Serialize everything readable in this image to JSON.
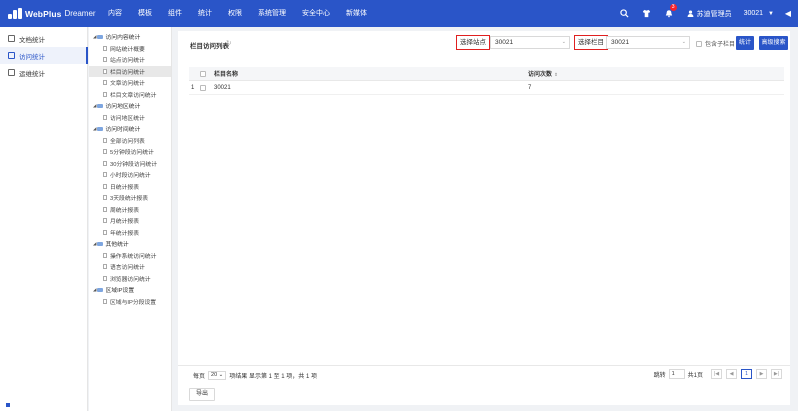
{
  "brand": {
    "name": "WebPlus",
    "sub": "Dreamer"
  },
  "nav": [
    "内容",
    "模板",
    "组件",
    "统计",
    "权限",
    "系统管理",
    "安全中心",
    "新媒体"
  ],
  "topbar": {
    "notification_count": "3",
    "user_name": "苏迪管理员",
    "site": "30021"
  },
  "sidebar": {
    "items": [
      {
        "label": "文档统计"
      },
      {
        "label": "访问统计"
      },
      {
        "label": "运维统计"
      }
    ]
  },
  "tree": {
    "nodes": [
      {
        "label": "访问内容统计",
        "type": "group"
      },
      {
        "label": "网站统计概要",
        "type": "leaf"
      },
      {
        "label": "站点访问统计",
        "type": "leaf"
      },
      {
        "label": "栏目访问统计",
        "type": "leaf"
      },
      {
        "label": "文章访问统计",
        "type": "leaf"
      },
      {
        "label": "栏目文章访问统计",
        "type": "leaf"
      },
      {
        "label": "访问地区统计",
        "type": "group"
      },
      {
        "label": "访问地区统计",
        "type": "leaf"
      },
      {
        "label": "访问时间统计",
        "type": "group"
      },
      {
        "label": "全部访问列表",
        "type": "leaf"
      },
      {
        "label": "5分钟段访问统计",
        "type": "leaf"
      },
      {
        "label": "30分钟段访问统计",
        "type": "leaf"
      },
      {
        "label": "小时段访问统计",
        "type": "leaf"
      },
      {
        "label": "日统计报表",
        "type": "leaf"
      },
      {
        "label": "3天段统计报表",
        "type": "leaf"
      },
      {
        "label": "周统计报表",
        "type": "leaf"
      },
      {
        "label": "月统计报表",
        "type": "leaf"
      },
      {
        "label": "年统计报表",
        "type": "leaf"
      },
      {
        "label": "其他统计",
        "type": "group"
      },
      {
        "label": "操作系统访问统计",
        "type": "leaf"
      },
      {
        "label": "语言访问统计",
        "type": "leaf"
      },
      {
        "label": "浏览器访问统计",
        "type": "leaf"
      },
      {
        "label": "区域IP设置",
        "type": "group"
      },
      {
        "label": "区域与IP分段设置",
        "type": "leaf"
      }
    ]
  },
  "main": {
    "title": "栏目访问列表",
    "filter": {
      "site_label": "选择站点",
      "site_value": "30021",
      "column_label": "选择栏目",
      "column_value": "30021",
      "include_sub": "包含子栏目",
      "stat_button": "统计",
      "advanced_button": "高级搜索"
    },
    "table": {
      "headers": {
        "name": "栏目名称",
        "count": "访问次数"
      },
      "rows": [
        {
          "index": "1",
          "name": "30021",
          "count": "7"
        }
      ]
    },
    "pager": {
      "per_page_label": "每页",
      "per_page": "20",
      "summary": "项结果 显示第 1 至 1 项，共 1 项",
      "jump_label": "跳转",
      "jump_value": "1",
      "total_pages": "共1页",
      "current_page": "1"
    },
    "export_button": "导出"
  }
}
